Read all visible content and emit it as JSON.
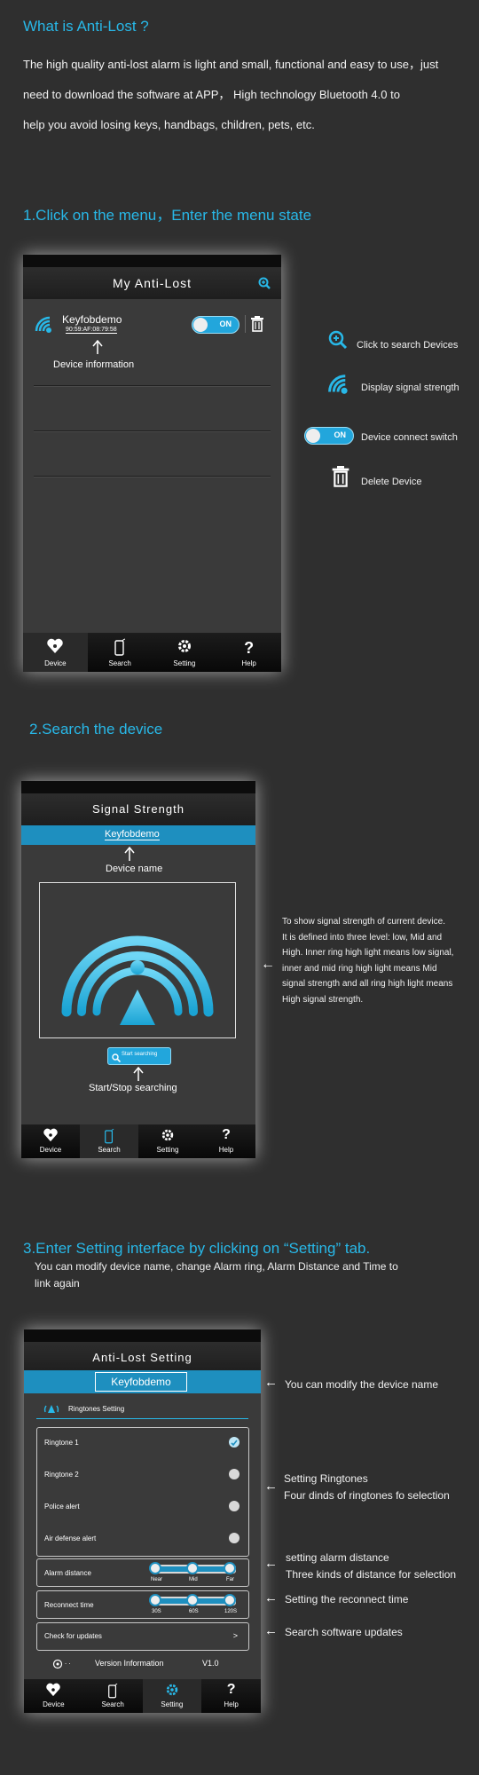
{
  "intro": {
    "title": "What is Anti-Lost ?",
    "lines": [
      "The high quality anti-lost alarm is light and small, functional and easy to use，just",
      "need to download the software at APP， High technology Bluetooth 4.0 to",
      "help you avoid losing keys, handbags, children, pets, etc."
    ]
  },
  "step1": {
    "heading": "1.Click on the menu，Enter the menu state",
    "screen_title": "My Anti-Lost",
    "device": {
      "name": "Keyfobdemo",
      "mac": "90:59:AF:08:79:58",
      "toggle": "ON"
    },
    "device_info_label": "Device information",
    "legend": {
      "search": "Click to search Devices",
      "signal": "Display signal strength",
      "switch_label": "ON",
      "switch": "Device connect switch",
      "delete": "Delete Device"
    }
  },
  "step2": {
    "heading": "2.Search the device",
    "screen_title": "Signal Strength",
    "device_name": "Keyfobdemo",
    "device_name_label": "Device name",
    "button": "Start searching",
    "button_label": "Start/Stop searching",
    "description": [
      "To show signal strength of current device.",
      "It is defined into three level: low, Mid and",
      "High. Inner ring high light means low signal,",
      "inner and mid ring high light means Mid",
      "signal strength and all ring high light means",
      "High signal strength."
    ]
  },
  "step3": {
    "heading": "3.Enter Setting interface by clicking on “Setting” tab.",
    "sub": [
      "You can modify device name, change Alarm ring, Alarm Distance and Time to",
      "link again"
    ],
    "screen_title": "Anti-Lost Setting",
    "device_name": "Keyfobdemo",
    "ringtones_header": "Ringtones Setting",
    "ringtones": [
      "Ringtone 1",
      "Ringtone   2",
      "Police alert",
      "Air defense alert"
    ],
    "selected_ringtone": 0,
    "alarm_distance": {
      "label": "Alarm distance",
      "ticks": [
        "Near",
        "Mid",
        "Far"
      ]
    },
    "reconnect": {
      "label": "Reconnect time",
      "ticks": [
        "30S",
        "60S",
        "120S"
      ]
    },
    "updates": {
      "label": "Check for updates",
      "arrow": ">"
    },
    "version": {
      "label": "Version Information",
      "value": "V1.0"
    },
    "annotations": {
      "name": "You can modify the device name",
      "ring1": "Setting Ringtones",
      "ring2": "Four dinds of ringtones fo selection",
      "dist1": "setting alarm distance",
      "dist2": "Three kinds of distance for selection",
      "reconnect": "Setting the reconnect time",
      "updates": "Search software updates"
    }
  },
  "tabs": [
    "Device",
    "Search",
    "Setting",
    "Help"
  ],
  "colors": {
    "accent": "#28b8e8",
    "background": "#2f2f2f",
    "bar": "#1e8fbf"
  }
}
